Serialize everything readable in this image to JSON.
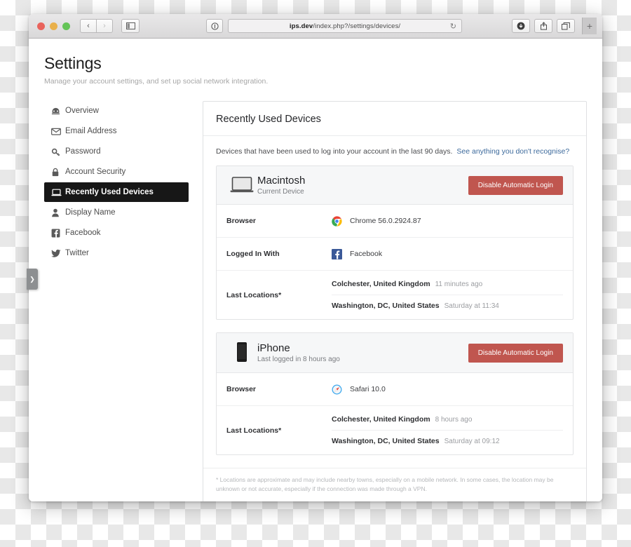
{
  "browser": {
    "url_host": "ips.dev",
    "url_path": "/index.php?/settings/devices/",
    "reader_icon": "reader-view-icon",
    "back_icon": "‹",
    "forward_icon": "›",
    "sidebar_icon": "▥",
    "reload_icon": "↻",
    "download_icon": "⬇",
    "share_icon": "↑",
    "tabs_icon": "❐",
    "newtab_icon": "+",
    "edge_tab_icon": "❯"
  },
  "page": {
    "title": "Settings",
    "subtitle": "Manage your account settings, and set up social network integration."
  },
  "sidebar": {
    "items": [
      {
        "label": "Overview",
        "icon": "dashboard-icon",
        "active": false
      },
      {
        "label": "Email Address",
        "icon": "envelope-icon",
        "active": false
      },
      {
        "label": "Password",
        "icon": "key-icon",
        "active": false
      },
      {
        "label": "Account Security",
        "icon": "lock-icon",
        "active": false
      },
      {
        "label": "Recently Used Devices",
        "icon": "laptop-icon",
        "active": true
      },
      {
        "label": "Display Name",
        "icon": "user-icon",
        "active": false
      },
      {
        "label": "Facebook",
        "icon": "facebook-icon",
        "active": false
      },
      {
        "label": "Twitter",
        "icon": "twitter-icon",
        "active": false
      }
    ]
  },
  "panel": {
    "title": "Recently Used Devices",
    "description": "Devices that have been used to log into your account in the last 90 days.",
    "link_text": "See anything you don't recognise?",
    "footnote": "* Locations are approximate and may include nearby towns, especially on a mobile network. In some cases, the location may be unknown or not accurate, especially if the connection was made through a VPN."
  },
  "devices": [
    {
      "name": "Macintosh",
      "status": "Current Device",
      "icon": "laptop-icon",
      "action_label": "Disable Automatic Login",
      "rows": [
        {
          "label": "Browser",
          "icon": "chrome-icon",
          "value": "Chrome 56.0.2924.87"
        },
        {
          "label": "Logged In With",
          "icon": "facebook-icon",
          "value": "Facebook"
        }
      ],
      "locations_label": "Last Locations*",
      "locations": [
        {
          "place": "Colchester, United Kingdom",
          "time": "11 minutes ago"
        },
        {
          "place": "Washington, DC, United States",
          "time": "Saturday at 11:34"
        }
      ]
    },
    {
      "name": "iPhone",
      "status": "Last logged in 8 hours ago",
      "icon": "phone-icon",
      "action_label": "Disable Automatic Login",
      "rows": [
        {
          "label": "Browser",
          "icon": "safari-icon",
          "value": "Safari 10.0"
        }
      ],
      "locations_label": "Last Locations*",
      "locations": [
        {
          "place": "Colchester, United Kingdom",
          "time": "8 hours ago"
        },
        {
          "place": "Washington, DC, United States",
          "time": "Saturday at 09:12"
        }
      ]
    }
  ],
  "colors": {
    "danger": "#c0564f",
    "link": "#3d6a9c",
    "active_nav_bg": "#171717"
  }
}
